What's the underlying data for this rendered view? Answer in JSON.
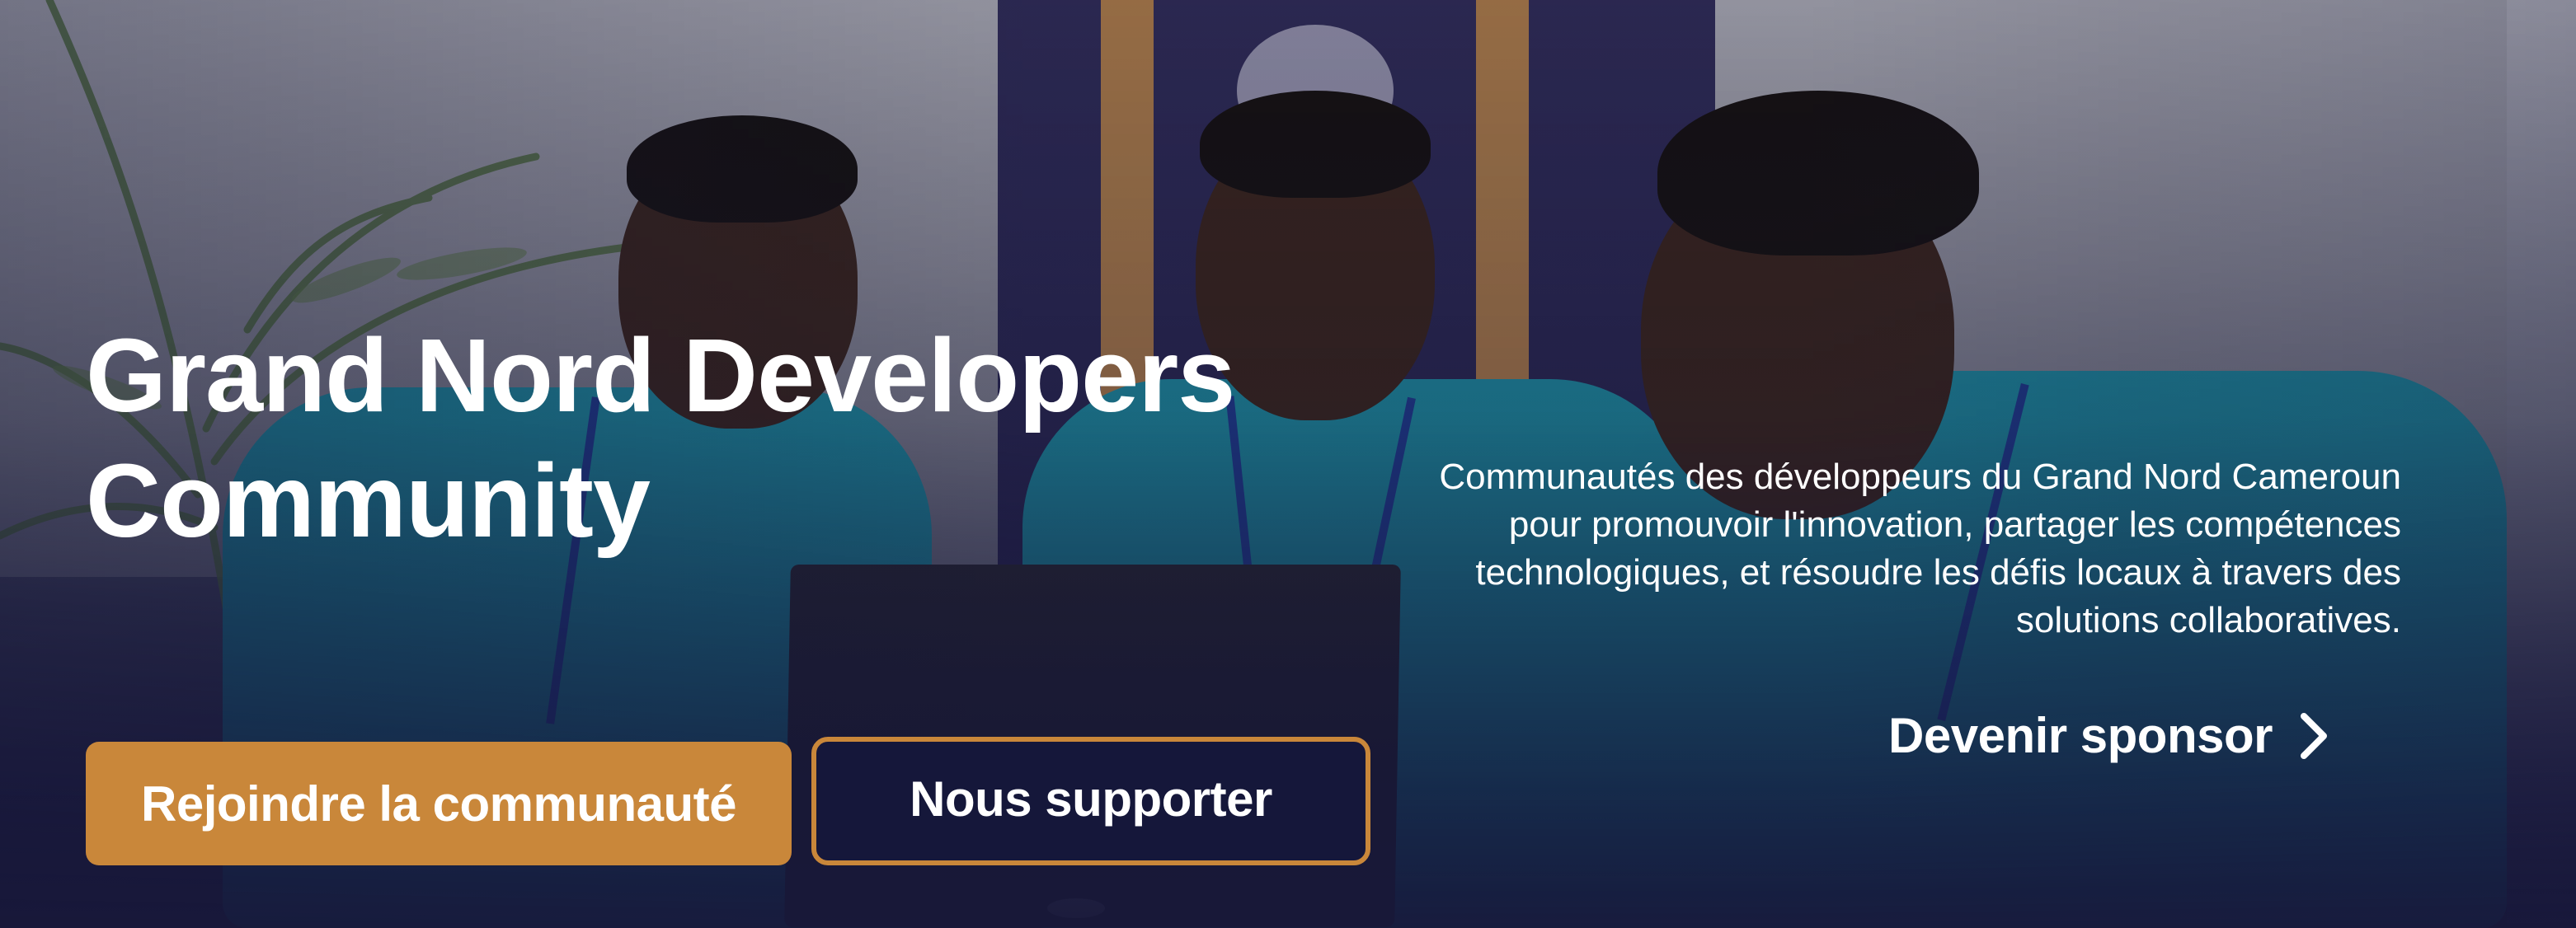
{
  "hero": {
    "title_line1": "Grand Nord Developers",
    "title_line2": "Community",
    "description": "Communautés des développeurs du Grand Nord Cameroun pour promouvoir l'innovation, partager les compétences technologiques, et résoudre les défis locaux à travers des solutions collaboratives.",
    "background_image": "team-photo"
  },
  "actions": {
    "primary_label": "Rejoindre la communauté",
    "secondary_label": "Nous supporter",
    "sponsor_label": "Devenir sponsor",
    "sponsor_icon": "chevron-right-icon"
  },
  "colors": {
    "accent": "#c9873a",
    "dark": "#15173a",
    "text": "#ffffff"
  }
}
